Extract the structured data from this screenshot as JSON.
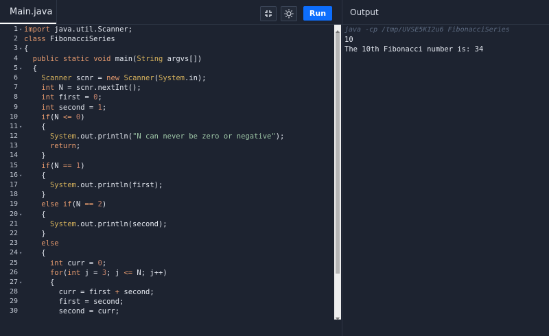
{
  "tab": {
    "label": "Main.java"
  },
  "toolbar": {
    "run_label": "Run",
    "collapse_icon": "collapse-icon",
    "theme_icon": "sun-icon"
  },
  "output": {
    "header": "Output",
    "command": "java -cp /tmp/UVSE5KI2u6 FibonacciSeries",
    "lines": [
      "10",
      "The 10th Fibonacci number is: 34"
    ]
  },
  "editor": {
    "line_numbers": [
      "1",
      "2",
      "3",
      "4",
      "5",
      "6",
      "7",
      "8",
      "9",
      "10",
      "11",
      "12",
      "13",
      "14",
      "15",
      "16",
      "17",
      "18",
      "19",
      "20",
      "21",
      "22",
      "23",
      "24",
      "25",
      "26",
      "27",
      "28",
      "29",
      "30"
    ],
    "fold_lines": [
      1,
      3,
      5,
      11,
      16,
      20,
      24,
      27
    ],
    "lines": [
      "import java.util.Scanner;",
      "class FibonacciSeries",
      "{",
      "  public static void main(String argvs[])",
      "  {",
      "    Scanner scnr = new Scanner(System.in);",
      "    int N = scnr.nextInt();",
      "    int first = 0;",
      "    int second = 1;",
      "    if(N <= 0)",
      "    {",
      "      System.out.println(\"N can never be zero or negative\");",
      "      return;",
      "    }",
      "    if(N == 1)",
      "    {",
      "      System.out.println(first);",
      "    }",
      "    else if(N == 2)",
      "    {",
      "      System.out.println(second);",
      "    }",
      "    else",
      "    {",
      "      int curr = 0;",
      "      for(int j = 3; j <= N; j++)",
      "      {",
      "        curr = first + second;",
      "        first = second;",
      "        second = curr;"
    ]
  }
}
